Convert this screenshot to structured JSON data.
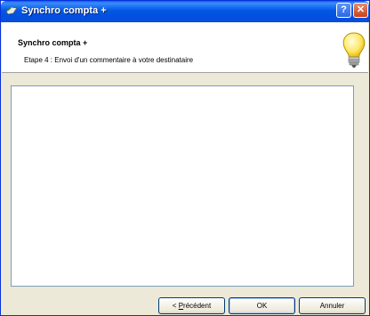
{
  "window": {
    "title": "Synchro compta +"
  },
  "header": {
    "title": "Synchro compta +",
    "subtitle": "Etape 4 : Envoi d'un commentaire à votre destinataire"
  },
  "buttons": {
    "previous_mnemonic": "P",
    "previous_rest": "récédent",
    "previous_prefix": "< ",
    "ok": "OK",
    "cancel": "Annuler"
  },
  "icons": {
    "app": "app-icon",
    "help": "help-icon",
    "close": "close-icon",
    "header": "lightbulb-icon"
  },
  "colors": {
    "titlebar": "#0058e6",
    "close": "#c8401c",
    "dialog_bg": "#ece9d8",
    "content_border": "#7f9db9"
  }
}
